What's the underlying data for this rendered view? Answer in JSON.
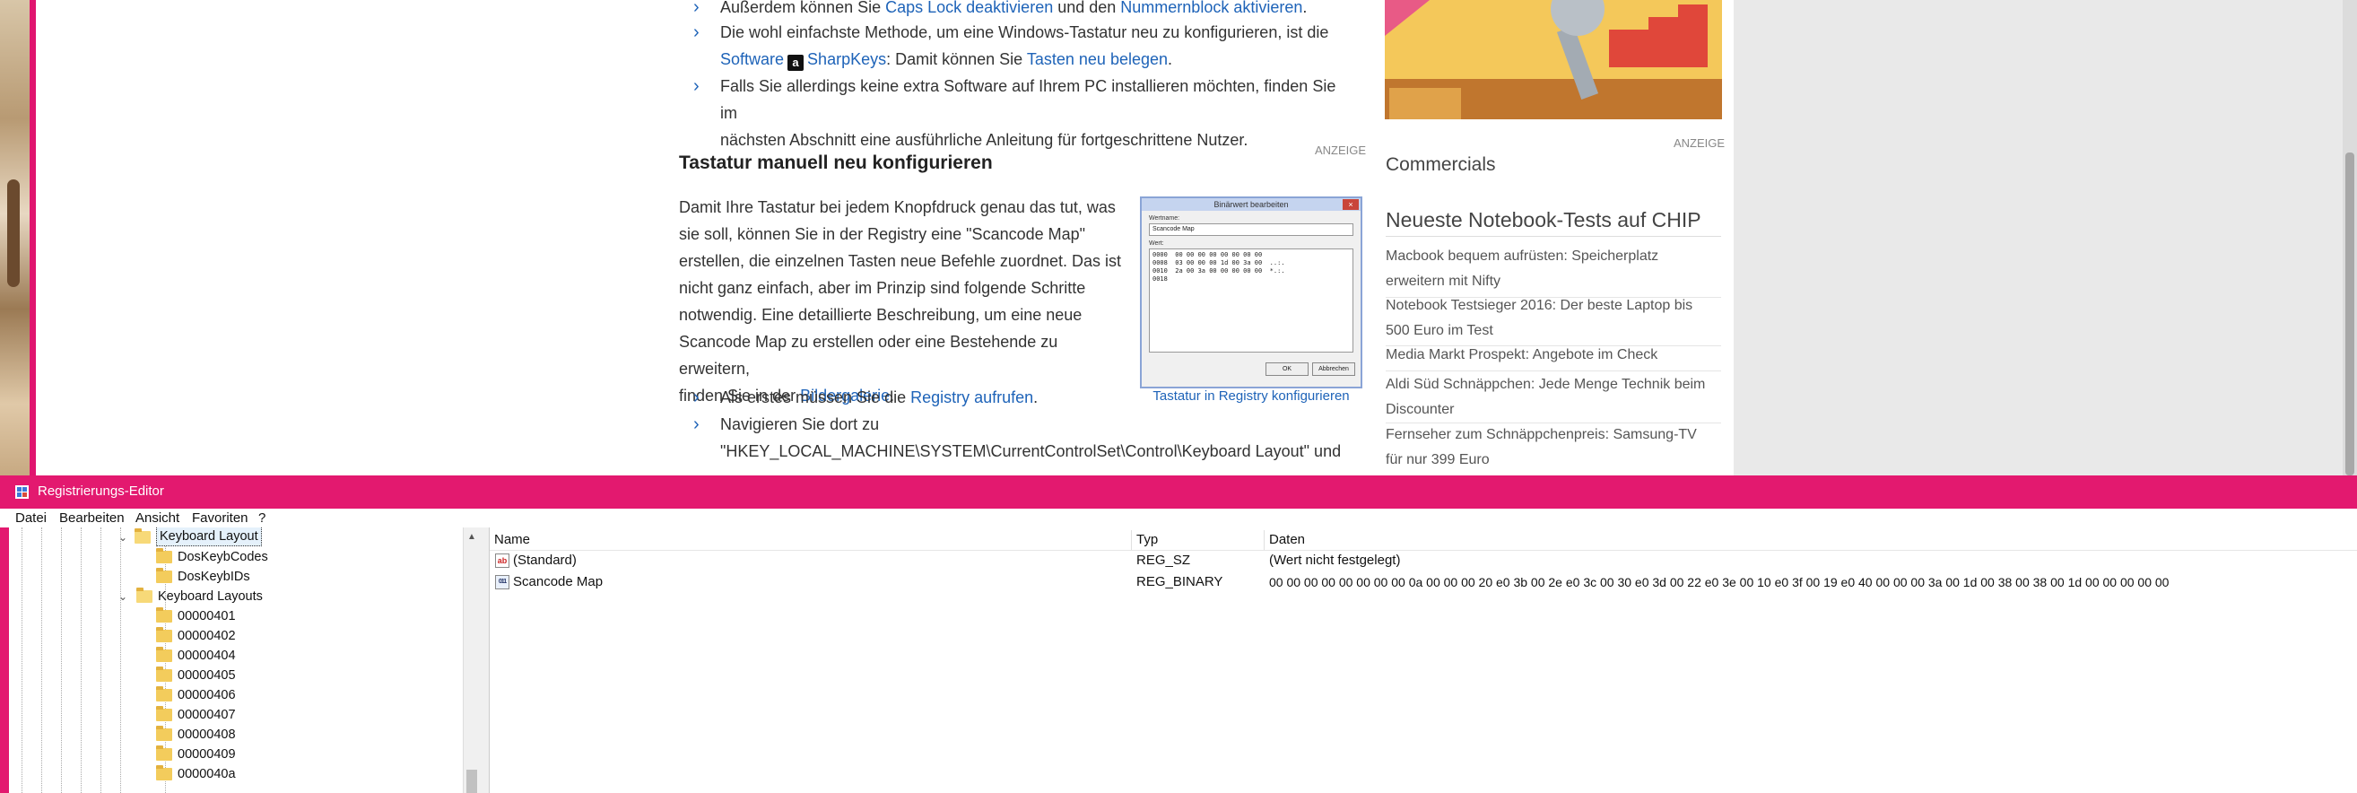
{
  "article": {
    "bullet1": {
      "prefix": "Außerdem können Sie ",
      "link1": "Caps Lock deaktivieren",
      "mid": " und den ",
      "link2": "Nummernblock aktivieren",
      "suffix": "."
    },
    "bullet2": {
      "line1": "Die wohl einfachste Methode, um eine Windows-Tastatur neu zu konfigurieren, ist die",
      "link_software": "Software",
      "amazon_badge": "a",
      "link_sharpkeys": "SharpKeys",
      "mid": ": Damit können Sie ",
      "link_remap": "Tasten neu belegen",
      "suffix": "."
    },
    "bullet3": {
      "line1": "Falls Sie allerdings keine extra Software auf Ihrem PC installieren möchten, finden Sie im",
      "line2": "nächsten Abschnitt eine ausführliche Anleitung für fortgeschrittene Nutzer."
    },
    "ad_label": "ANZEIGE",
    "section_title": "Tastatur manuell neu konfigurieren",
    "paragraph": {
      "lines": [
        "Damit Ihre Tastatur bei jedem Knopfdruck genau das tut, was",
        "sie soll, können Sie in der Registry eine \"Scancode Map\"",
        "erstellen, die einzelnen Tasten neue Befehle zuordnet. Das ist",
        "nicht ganz einfach, aber im Prinzip sind folgende Schritte",
        "notwendig. Eine detaillierte Beschreibung, um eine neue",
        "Scancode Map zu erstellen oder eine Bestehende zu erweitern,"
      ],
      "last_prefix": "finden Sie in der ",
      "last_link": "Bildergalerie",
      "last_suffix": "."
    },
    "thumbnail": {
      "dialog_title": "Binärwert bearbeiten",
      "close_label": "×",
      "name_label": "Wertname:",
      "name_value": "Scancode Map",
      "data_label": "Wert:",
      "hex_dump": "0000  00 00 00 00 00 00 00 00\n0008  03 00 00 00 1d 00 3a 00  ..:.\n0010  2a 00 3a 00 00 00 00 00  *.:.\n0018",
      "ok_label": "OK",
      "cancel_label": "Abbrechen",
      "caption": "Tastatur in Registry konfigurieren"
    },
    "bullet4": {
      "prefix": "Als erstes müssen Sie die ",
      "link": "Registry aufrufen",
      "suffix": "."
    },
    "bullet5": {
      "line1": "Navigieren Sie dort zu",
      "line2": "\"HKEY_LOCAL_MACHINE\\SYSTEM\\CurrentControlSet\\Control\\Keyboard Layout\" und"
    }
  },
  "sidebar": {
    "ad_label": "ANZEIGE",
    "commercials": "Commercials",
    "notebook_title": "Neueste Notebook-Tests auf CHIP",
    "notebook_items": [
      {
        "l1": "Macbook bequem aufrüsten: Speicherplatz",
        "l2": "erweitern mit Nifty"
      },
      {
        "l1": "Notebook Testsieger 2016: Der beste Laptop bis",
        "l2": "500 Euro im Test"
      },
      {
        "l1": "Media Markt Prospekt: Angebote im Check",
        "l2": ""
      },
      {
        "l1": "Aldi Süd Schnäppchen: Jede Menge Technik beim",
        "l2": "Discounter"
      },
      {
        "l1": "Fernseher zum Schnäppchenpreis: Samsung-TV",
        "l2": "für nur 399 Euro"
      }
    ]
  },
  "regedit": {
    "title": "Registrierungs-Editor",
    "menu": [
      "Datei",
      "Bearbeiten",
      "Ansicht",
      "Favoriten",
      "?"
    ],
    "tree": {
      "keyboard_layout": "Keyboard Layout",
      "dos_keyb_codes": "DosKeybCodes",
      "dos_keyb_ids": "DosKeybIDs",
      "keyboard_layouts": "Keyboard Layouts",
      "layout_keys": [
        "00000401",
        "00000402",
        "00000404",
        "00000405",
        "00000406",
        "00000407",
        "00000408",
        "00000409",
        "0000040a"
      ],
      "expand_glyph": "⌄",
      "collapse_glyph": "⌄"
    },
    "columns": {
      "name": "Name",
      "type": "Typ",
      "data": "Daten"
    },
    "values": [
      {
        "icon": "string-value-icon",
        "icon_text": "ab",
        "name": "(Standard)",
        "type": "REG_SZ",
        "data": "(Wert nicht festgelegt)"
      },
      {
        "icon": "binary-value-icon",
        "icon_text": "011",
        "name": "Scancode Map",
        "type": "REG_BINARY",
        "data": "00 00 00 00 00 00 00 00 0a 00 00 00 20 e0 3b 00 2e e0 3c 00 30 e0 3d 00 22 e0 3e 00 10 e0 3f 00 19 e0 40 00 00 00 3a 00 1d 00 38 00 38 00 1d 00 00 00 00 00"
      }
    ],
    "scroll_up_glyph": "▲"
  },
  "colors": {
    "accent_pink": "#e3196f",
    "link_blue": "#1e63b8",
    "folder_yellow": "#f3cc5c"
  }
}
